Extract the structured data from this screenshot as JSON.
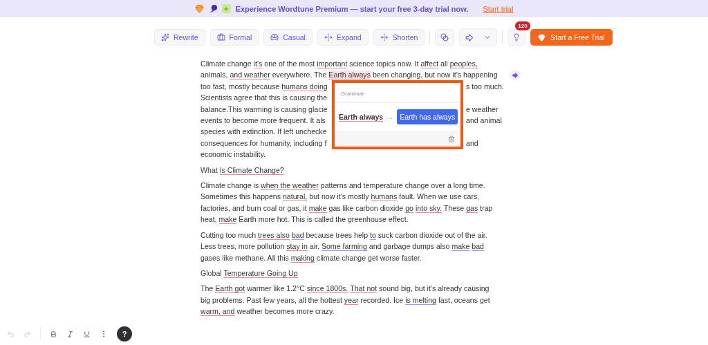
{
  "banner": {
    "message": "Experience Wordtune Premium — start your free 3-day trial now.",
    "link": "Start trial"
  },
  "toolbar": {
    "tools": [
      "Rewrite",
      "Formal",
      "Casual",
      "Expand",
      "Shorten"
    ],
    "badge": "120",
    "trial_button": "Start a Free Trial"
  },
  "document": [
    {
      "kind": "paragraph",
      "lines": [
        {
          "left": [
            {
              "t": "Climate change "
            },
            {
              "t": "it’s",
              "kind": "grammar"
            },
            {
              "t": " one of the most "
            },
            {
              "t": "important",
              "kind": "grammar"
            },
            {
              "t": " science topics now. It "
            },
            {
              "t": "affect",
              "kind": "grammar"
            },
            {
              "t": " all "
            },
            {
              "t": "peoples,",
              "kind": "grammar"
            }
          ]
        },
        {
          "left": [
            {
              "t": "animals, "
            },
            {
              "t": "and weather",
              "kind": "grammar"
            },
            {
              "t": " everywhere. The "
            },
            {
              "t": "Earth always",
              "kind": "active"
            },
            {
              "t": " been changing, but now it’s happening"
            }
          ]
        },
        {
          "left": [
            {
              "t": "too fast, mostly because "
            },
            {
              "t": "humans doing",
              "kind": "grammar"
            }
          ],
          "right": [
            {
              "t": "s too much."
            }
          ]
        },
        {
          "left": [
            {
              "t": "Scientists agree that this is causing the"
            }
          ]
        },
        {
          "left": [
            {
              "t": "balance.This warming is causing glacie"
            }
          ],
          "right": [
            {
              "t": "e weather"
            }
          ]
        },
        {
          "left": [
            {
              "t": "events to become more frequent. It als"
            }
          ],
          "right": [
            {
              "t": "and animal"
            }
          ]
        },
        {
          "left": [
            {
              "t": "species with extinction. If left unchecke"
            }
          ]
        },
        {
          "left": [
            {
              "t": "consequences for humanity, including f"
            }
          ],
          "right": [
            {
              "t": "and"
            }
          ]
        },
        {
          "left": [
            {
              "t": "economic instability."
            }
          ]
        }
      ]
    },
    {
      "kind": "heading",
      "lines": [
        {
          "left": [
            {
              "t": "What "
            },
            {
              "t": "Is Climate Change?",
              "kind": "grammar"
            }
          ]
        }
      ]
    },
    {
      "kind": "paragraph",
      "lines": [
        {
          "left": [
            {
              "t": "Climate change is "
            },
            {
              "t": "when the weather",
              "kind": "grammar"
            },
            {
              "t": " patterns and temperature change over a long time."
            }
          ]
        },
        {
          "left": [
            {
              "t": "Sometimes this happens "
            },
            {
              "t": "natural,",
              "kind": "grammar"
            },
            {
              "t": " but now it’s mostly "
            },
            {
              "t": "humans",
              "kind": "grammar"
            },
            {
              "t": " fault. When we use cars,"
            }
          ]
        },
        {
          "left": [
            {
              "t": "factories, and burn coal or gas, it "
            },
            {
              "t": "make",
              "kind": "grammar"
            },
            {
              "t": " gas like carbon dioxide "
            },
            {
              "t": "go",
              "kind": "clarity"
            },
            {
              "t": "into sky.",
              "kind": "grammar"
            },
            {
              "t": " These "
            },
            {
              "t": "gas",
              "kind": "grammar"
            },
            {
              "t": " trap"
            }
          ]
        },
        {
          "left": [
            {
              "t": "heat, "
            },
            {
              "t": "make",
              "kind": "grammar"
            },
            {
              "t": " Earth more hot. This is called the greenhouse effect."
            }
          ]
        }
      ]
    },
    {
      "kind": "paragraph",
      "lines": [
        {
          "left": [
            {
              "t": "Cutting too much "
            },
            {
              "t": "trees also",
              "kind": "grammar"
            },
            {
              "t": "bad",
              "kind": "clarity"
            },
            {
              "t": " because trees help "
            },
            {
              "t": "to",
              "kind": "clarity"
            },
            {
              "t": " suck carbon dioxide out of the air."
            }
          ]
        },
        {
          "left": [
            {
              "t": "Less trees, more pollution "
            },
            {
              "t": "stay in",
              "kind": "grammar"
            },
            {
              "t": " air. "
            },
            {
              "t": "Some farming",
              "kind": "clarity"
            },
            {
              "t": " and garbage dumps also "
            },
            {
              "t": "make",
              "kind": "clarity"
            },
            {
              "t": "bad",
              "kind": "clarity"
            }
          ]
        },
        {
          "left": [
            {
              "t": "gases like methane. All this "
            },
            {
              "t": "making",
              "kind": "grammar"
            },
            {
              "t": " climate change get worse faster."
            }
          ]
        }
      ]
    },
    {
      "kind": "heading",
      "lines": [
        {
          "left": [
            {
              "t": "Global "
            },
            {
              "t": "Temperature Going Up",
              "kind": "grammar"
            }
          ]
        }
      ]
    },
    {
      "kind": "paragraph",
      "lines": [
        {
          "left": [
            {
              "t": "The "
            },
            {
              "t": "Earth got",
              "kind": "grammar"
            },
            {
              "t": " warmer like 1.2°C "
            },
            {
              "t": "since 1800s.",
              "kind": "grammar"
            },
            {
              "t": "That not",
              "kind": "grammar"
            },
            {
              "t": " sound big, but it’s already causing"
            }
          ]
        },
        {
          "left": [
            {
              "t": "big problems. Past few years, all the hottest "
            },
            {
              "t": "year",
              "kind": "grammar"
            },
            {
              "t": " recorded. Ice "
            },
            {
              "t": "is melting",
              "kind": "clarity"
            },
            {
              "t": " fast, oceans get"
            }
          ]
        },
        {
          "left": [
            {
              "t": "warm, and",
              "kind": "grammar"
            },
            {
              "t": " weather becomes more crazy."
            }
          ]
        }
      ]
    }
  ],
  "popup": {
    "category": "Grammar",
    "original": "Earth always",
    "arrow": "→",
    "suggestion": "Earth has always"
  },
  "bottom_bar": {
    "undo_disabled": true,
    "redo_disabled": true,
    "help": "?"
  }
}
